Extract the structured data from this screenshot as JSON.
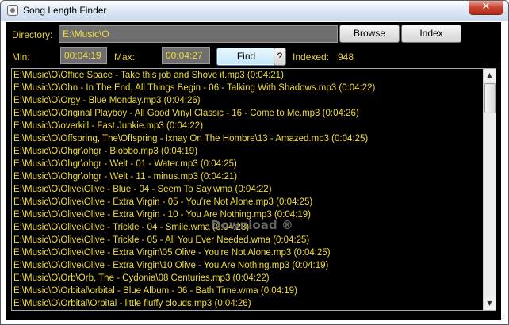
{
  "window": {
    "title": "Song Length Finder",
    "close_glyph": "✕"
  },
  "controls": {
    "directory_label": "Directory:",
    "directory_value": "E:\\Music\\O",
    "browse_label": "Browse",
    "index_label": "Index",
    "min_label": "Min:",
    "min_value": "00:04:19",
    "max_label": "Max:",
    "max_value": "00:04:27",
    "find_label": "Find",
    "help_label": "?",
    "indexed_label": "Indexed:",
    "indexed_value": "948"
  },
  "results": [
    "E:\\Music\\O\\Office Space - Take this job and Shove it.mp3  (0:04:21)",
    "E:\\Music\\O\\Ohn - In The End, All Things Begin - 06 - Talking With Shadows.mp3  (0:04:22)",
    "E:\\Music\\O\\Orgy - Blue Monday.mp3  (0:04:26)",
    "E:\\Music\\O\\Original Playboy - All Good Vinyl Classic - 16 - Come to Me.mp3  (0:04:26)",
    "E:\\Music\\O\\overkill - Fast Junkie.mp3  (0:04:22)",
    "E:\\Music\\O\\Offspring, The\\Offspring - Ixnay On The Hombre\\13 - Amazed.mp3  (0:04:25)",
    "E:\\Music\\O\\Ohgr\\ohgr - Blobbo.mp3  (0:04:19)",
    "E:\\Music\\O\\Ohgr\\ohgr - Welt - 01 - Water.mp3  (0:04:25)",
    "E:\\Music\\O\\Ohgr\\ohgr - Welt - 11 - minus.mp3  (0:04:21)",
    "E:\\Music\\O\\Olive\\Olive - Blue - 04 - Seem To Say.wma  (0:04:22)",
    "E:\\Music\\O\\Olive\\Olive - Extra Virgin - 05 - You're Not Alone.mp3  (0:04:25)",
    "E:\\Music\\O\\Olive\\Olive - Extra Virgin - 10 - You Are Nothing.mp3  (0:04:19)",
    "E:\\Music\\O\\Olive\\Olive - Trickle - 04 - Smile.wma  (0:04:23)",
    "E:\\Music\\O\\Olive\\Olive - Trickle - 05 - All You Ever Needed.wma  (0:04:25)",
    "E:\\Music\\O\\Olive\\Olive - Extra Virgin\\05 Olive - You're Not Alone.mp3  (0:04:25)",
    "E:\\Music\\O\\Olive\\Olive - Extra Virgin\\10 Olive - You Are Nothing.mp3  (0:04:19)",
    "E:\\Music\\O\\Orb\\Orb, The - Cydonia\\08 Centuries.mp3  (0:04:22)",
    "E:\\Music\\O\\Orbital\\orbital - Blue Album - 06 - Bath Time.wma  (0:04:19)",
    "E:\\Music\\O\\Orbital\\Orbital - little fluffy clouds.mp3  (0:04:26)"
  ],
  "scrollbar": {
    "up_glyph": "▲",
    "down_glyph": "▼"
  },
  "watermark": "Download ®",
  "colors": {
    "text_yellow": "#f0dc3e",
    "background": "#000000",
    "field_gray": "#6e6e6e"
  }
}
